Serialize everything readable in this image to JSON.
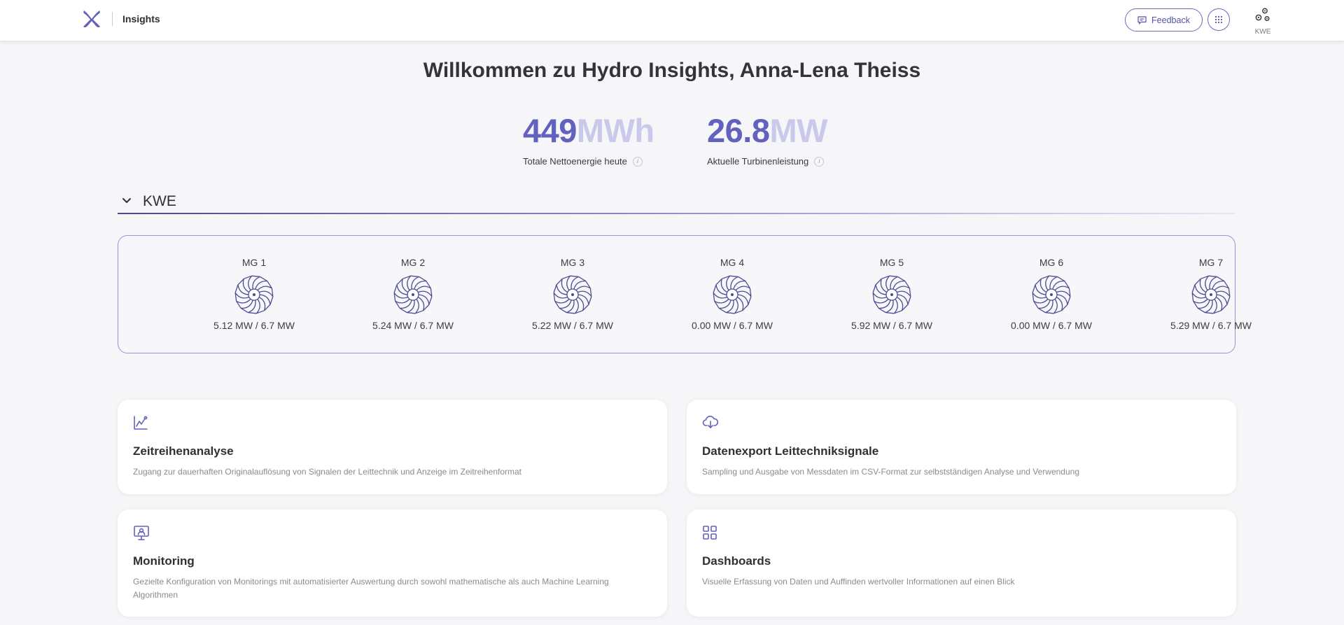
{
  "header": {
    "app_title": "Insights",
    "feedback_label": "Feedback",
    "plant_label": "KWE"
  },
  "welcome": "Willkommen zu Hydro Insights, Anna-Lena Theiss",
  "kpis": [
    {
      "value": "449",
      "unit": "MWh",
      "caption": "Totale Nettoenergie heute"
    },
    {
      "value": "26.8",
      "unit": "MW",
      "caption": "Aktuelle Turbinenleistung"
    }
  ],
  "section": {
    "title": "KWE"
  },
  "units": [
    {
      "name": "MG 1",
      "power": "5.12 MW / 6.7 MW"
    },
    {
      "name": "MG 2",
      "power": "5.24 MW / 6.7 MW"
    },
    {
      "name": "MG 3",
      "power": "5.22 MW / 6.7 MW"
    },
    {
      "name": "MG 4",
      "power": "0.00 MW / 6.7 MW"
    },
    {
      "name": "MG 5",
      "power": "5.92 MW / 6.7 MW"
    },
    {
      "name": "MG 6",
      "power": "0.00 MW / 6.7 MW"
    },
    {
      "name": "MG 7",
      "power": "5.29 MW / 6.7 MW"
    }
  ],
  "cards": [
    {
      "icon": "line-chart-icon",
      "title": "Zeitreihenanalyse",
      "description": "Zugang zur dauerhaften Originalauflösung von Signalen der Leittechnik und Anzeige im Zeitreihenformat"
    },
    {
      "icon": "cloud-download-icon",
      "title": "Datenexport Leittechniksignale",
      "description": "Sampling und Ausgabe von Messdaten im CSV-Format zur selbstständigen Analyse und Verwendung"
    },
    {
      "icon": "monitor-icon",
      "title": "Monitoring",
      "description": "Gezielte Konfiguration von Monitorings mit automatisierter Auswertung durch sowohl mathematische als auch Machine Learning Algorithmen"
    },
    {
      "icon": "dashboard-grid-icon",
      "title": "Dashboards",
      "description": "Visuelle Erfassung von Daten und Auffinden wertvoller Informationen auf einen Blick"
    }
  ],
  "colors": {
    "accent": "#6261bd",
    "accent_light": "#c9c9ea",
    "border": "#9594d6"
  }
}
